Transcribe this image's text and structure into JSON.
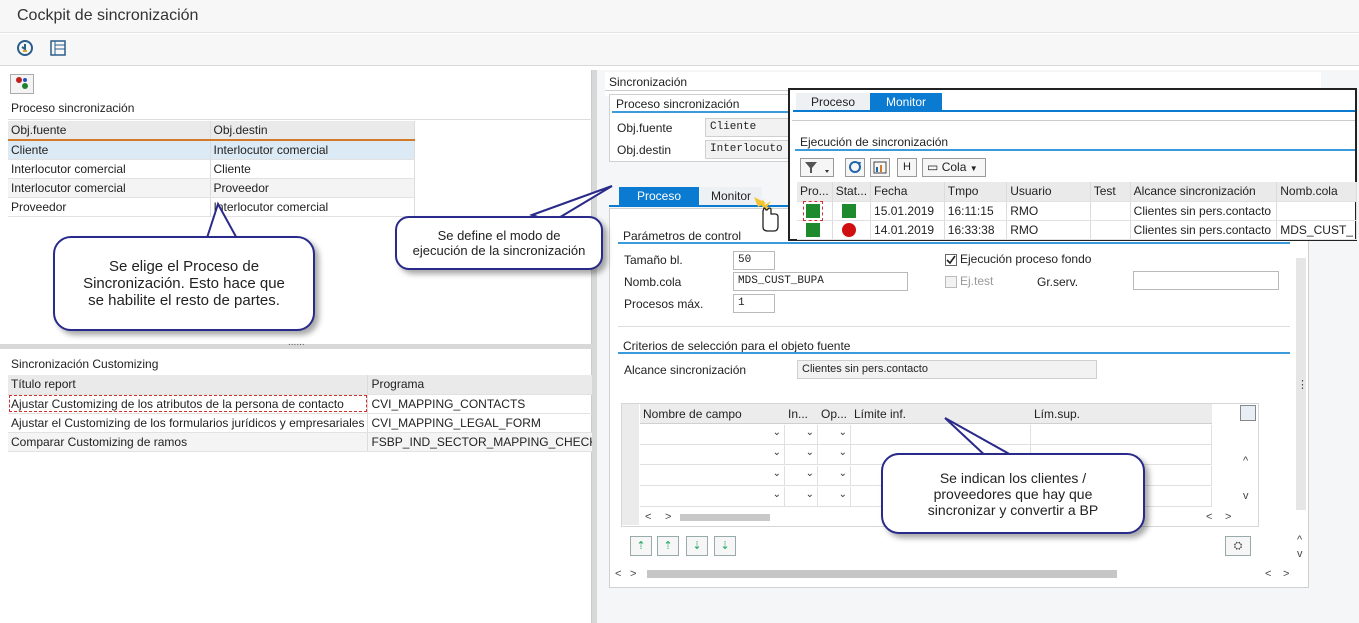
{
  "window": {
    "title": "Cockpit de sincronización"
  },
  "toolbar": {
    "icons": [
      "execute-icon",
      "layout-icon"
    ]
  },
  "left": {
    "process_section_title": "Proceso sincronización",
    "process_table": {
      "columns": [
        "Obj.fuente",
        "Obj.destin"
      ],
      "rows": [
        [
          "Cliente",
          "Interlocutor comercial"
        ],
        [
          "Interlocutor comercial",
          "Cliente"
        ],
        [
          "Interlocutor comercial",
          "Proveedor"
        ],
        [
          "Proveedor",
          "Interlocutor comercial"
        ]
      ]
    },
    "customizing_section_title": "Sincronización Customizing",
    "customizing_table": {
      "columns": [
        "Título report",
        "Programa"
      ],
      "rows": [
        [
          "Ajustar Customizing de los atributos de la persona de contacto",
          "CVI_MAPPING_CONTACTS"
        ],
        [
          "Ajustar el Customizing de los formularios jurídicos y empresariales",
          "CVI_MAPPING_LEGAL_FORM"
        ],
        [
          "Comparar Customizing de ramos",
          "FSBP_IND_SECTOR_MAPPING_CHECK"
        ]
      ]
    },
    "splitter_grip": "......"
  },
  "right": {
    "section_title": "Sincronización",
    "process_group_title": "Proceso sincronización",
    "obj_fuente_label": "Obj.fuente",
    "obj_fuente_value": "Cliente",
    "obj_destin_label": "Obj.destin",
    "obj_destin_value": "Interlocuto",
    "tabs": [
      "Proceso",
      "Monitor"
    ],
    "control_params_title": "Parámetros de control",
    "tamano_label": "Tamaño bl.",
    "tamano_value": "50",
    "nomb_cola_label": "Nomb.cola",
    "nomb_cola_value": "MDS_CUST_BUPA",
    "procesos_label": "Procesos máx.",
    "procesos_value": "1",
    "ejecucion_label": "Ejecución proceso fondo",
    "ejtest_label": "Ej.test",
    "grserv_label": "Gr.serv.",
    "criteria_title": "Criterios de selección para el objeto fuente",
    "alcance_label": "Alcance sincronización",
    "alcance_value": "Clientes sin pers.contacto",
    "criteria_columns": [
      "Nombre de campo",
      "In...",
      "Op...",
      "Límite inf.",
      "Lím.sup."
    ]
  },
  "monitor_popup": {
    "tabs": [
      "Proceso",
      "Monitor"
    ],
    "title": "Ejecución de sincronización",
    "cola_button": "Cola",
    "columns": [
      "Pro...",
      "Stat...",
      "Fecha",
      "Tmpo",
      "Usuario",
      "Test",
      "Alcance sincronización",
      "Nomb.cola"
    ],
    "rows": [
      {
        "status_color": "#1e8a2e",
        "fecha": "15.01.2019",
        "tmpo": "16:11:15",
        "usuario": "RMO",
        "test": "",
        "alcance": "Clientes sin pers.contacto",
        "cola": ""
      },
      {
        "status_color": "#d01010",
        "fecha": "14.01.2019",
        "tmpo": "16:33:38",
        "usuario": "RMO",
        "test": "",
        "alcance": "Clientes sin pers.contacto",
        "cola": "MDS_CUST_"
      }
    ]
  },
  "callouts": {
    "proceso": "Se elige el Proceso de Sincronización. Esto hace que se habilite el resto de partes.",
    "modo": "Se define el modo de ejecución de la sincronización",
    "clientes": "Se indican los clientes / proveedores que hay que sincronizar y convertir a BP"
  },
  "colors": {
    "accent": "#0a7bd0",
    "selection": "#dceaf5",
    "bubble_border": "#2a2a8a"
  }
}
